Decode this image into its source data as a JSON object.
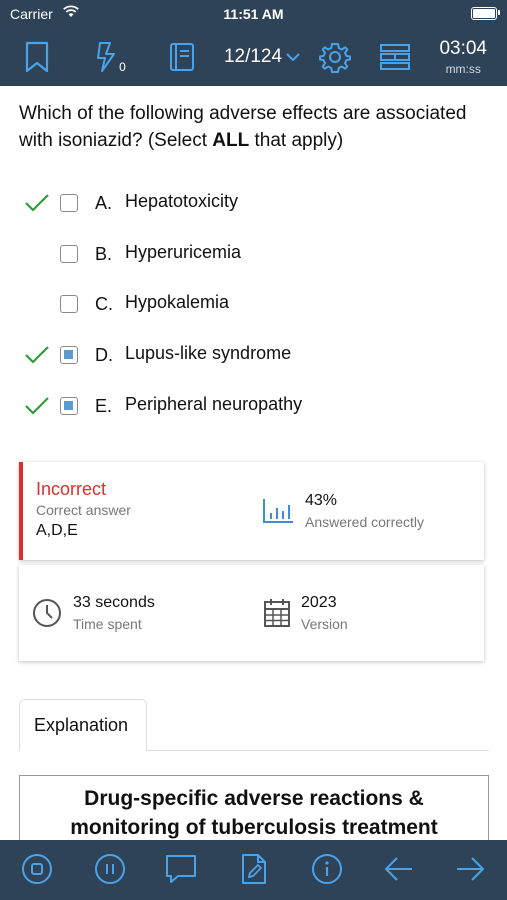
{
  "status": {
    "carrier": "Carrier",
    "time": "11:51 AM"
  },
  "toolbar": {
    "counter": "12/124",
    "lightning_count": "0",
    "timer": "03:04",
    "timer_unit": "mm:ss"
  },
  "question": {
    "text_before": "Which of the following adverse effects are associated with isoniazid?  (Select ",
    "emphasis": "ALL",
    "text_after": " that apply)"
  },
  "options": [
    {
      "letter": "A.",
      "text": "Hepatotoxicity",
      "correct": true,
      "selected": false
    },
    {
      "letter": "B.",
      "text": "Hyperuricemia",
      "correct": false,
      "selected": false
    },
    {
      "letter": "C.",
      "text": "Hypokalemia",
      "correct": false,
      "selected": false
    },
    {
      "letter": "D.",
      "text": "Lupus-like syndrome",
      "correct": true,
      "selected": true
    },
    {
      "letter": "E.",
      "text": "Peripheral neuropathy",
      "correct": true,
      "selected": true
    }
  ],
  "result": {
    "status": "Incorrect",
    "correct_answer_label": "Correct answer",
    "correct_answer": "A,D,E",
    "percent": "43%",
    "percent_label": "Answered correctly",
    "time_value": "33 seconds",
    "time_label": "Time spent",
    "version_value": "2023",
    "version_label": "Version"
  },
  "explanation": {
    "tab_label": "Explanation",
    "title_line1": "Drug-specific adverse reactions &",
    "title_line2": "monitoring of tuberculosis treatment"
  },
  "colors": {
    "bar": "#2f4358",
    "accent": "#3a8fd6",
    "correct": "#2e9e3a",
    "incorrect": "#d9302a"
  },
  "icons": [
    "bookmark-icon",
    "lightning-icon",
    "notebook-icon",
    "gear-icon",
    "layout-icon",
    "stop-icon",
    "pause-icon",
    "comment-icon",
    "notes-icon",
    "info-icon",
    "arrow-left-icon",
    "arrow-right-icon"
  ]
}
